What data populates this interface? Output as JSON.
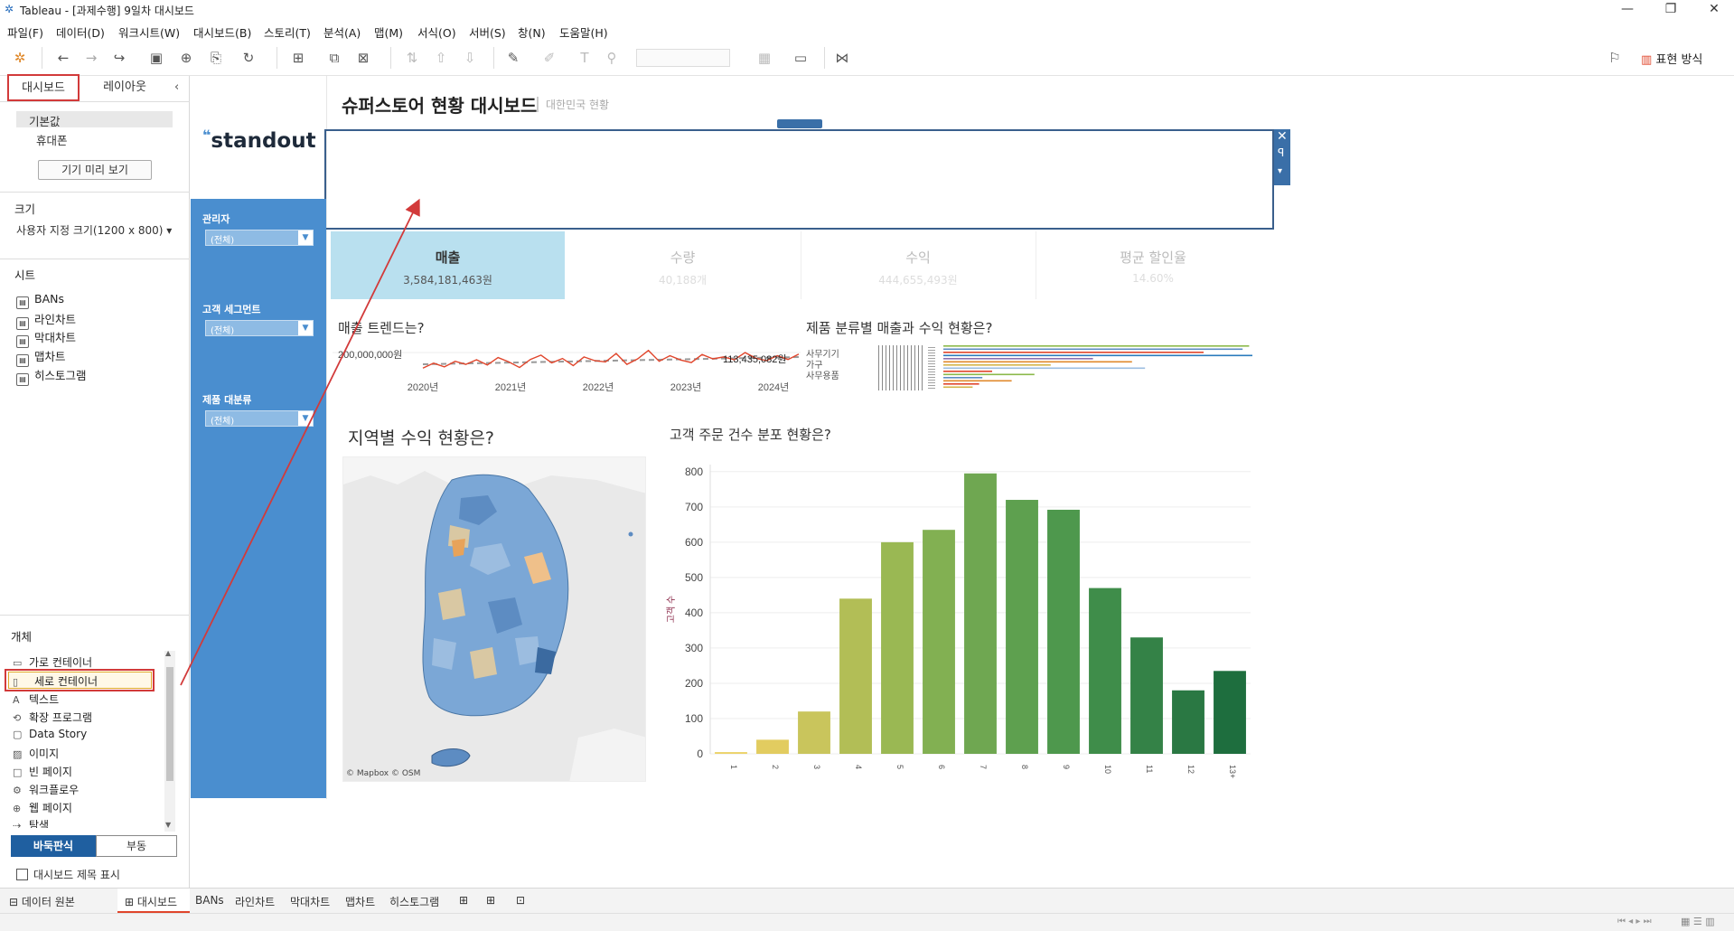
{
  "window": {
    "title": "Tableau - [과제수행] 9일차 대시보드"
  },
  "menu": [
    "파일(F)",
    "데이터(D)",
    "워크시트(W)",
    "대시보드(B)",
    "스토리(T)",
    "분석(A)",
    "맵(M)",
    "서식(O)",
    "서버(S)",
    "창(N)",
    "도움말(H)"
  ],
  "toolbar": {
    "show_me_label": "표현 방식"
  },
  "left_panel": {
    "tabs": [
      "대시보드",
      "레이아웃"
    ],
    "devices": [
      "기본값",
      "휴대폰"
    ],
    "preview_button": "기기 미리 보기",
    "size_title": "크기",
    "size_value": "사용자 지정 크기(1200 x 800)",
    "sheets_title": "시트",
    "sheets": [
      "BANs",
      "라인차트",
      "막대차트",
      "맵차트",
      "히스토그램"
    ],
    "objects_title": "개체",
    "objects": [
      {
        "icon": "horizontal-container-icon",
        "label": "가로 컨테이너"
      },
      {
        "icon": "vertical-container-icon",
        "label": "세로 컨테이너"
      },
      {
        "icon": "text-icon",
        "label": "텍스트"
      },
      {
        "icon": "extension-icon",
        "label": "확장 프로그램"
      },
      {
        "icon": "data-story-icon",
        "label": "Data Story"
      },
      {
        "icon": "image-icon",
        "label": "이미지"
      },
      {
        "icon": "blank-icon",
        "label": "빈 페이지"
      },
      {
        "icon": "workflow-icon",
        "label": "워크플로우"
      },
      {
        "icon": "web-page-icon",
        "label": "웹 페이지"
      },
      {
        "icon": "navigation-icon",
        "label": "탐색"
      }
    ],
    "mode_buttons": [
      "바둑판식",
      "부동"
    ],
    "show_title_label": "대시보드 제목 표시"
  },
  "dashboard": {
    "logo": "standout",
    "title": "슈퍼스토어 현황 대시보드",
    "subtitle": "대한민국 현황",
    "filters": [
      {
        "label": "관리자",
        "value": "(전체)"
      },
      {
        "label": "고객 세그먼트",
        "value": "(전체)"
      },
      {
        "label": "제품 대분류",
        "value": "(전체)"
      }
    ],
    "bans": [
      {
        "label": "매출",
        "value": "3,584,181,463원",
        "active": true
      },
      {
        "label": "수량",
        "value": "40,188개",
        "active": false
      },
      {
        "label": "수익",
        "value": "444,655,493원",
        "active": false
      },
      {
        "label": "평균 할인율",
        "value": "14.60%",
        "active": false
      }
    ],
    "q_trend": "매출 트렌드는?",
    "q_category": "제품 분류별 매출과 수익 현황은?",
    "q_map": "지역별 수익 현황은?",
    "q_hist": "고객 주문 건수 분포 현황은?",
    "trend_ytick": "200,000,000원",
    "trend_last_label": "113,435,082원",
    "trend_years": [
      "2020년",
      "2021년",
      "2022년",
      "2023년",
      "2024년"
    ],
    "category_labels": [
      "사무기기",
      "가구",
      "사무용품"
    ],
    "map_credit": "© Mapbox © OSM",
    "hist_ylabel": "고객 수"
  },
  "chart_data": [
    {
      "type": "line",
      "title": "매출 트렌드는?",
      "x": [
        "2020년",
        "2021년",
        "2022년",
        "2023년",
        "2024년"
      ],
      "series": [
        {
          "values": [
            68,
            84,
            72,
            90,
            80,
            95,
            78,
            102,
            88,
            70,
            96,
            110,
            85,
            99,
            76,
            104,
            92,
            88,
            115,
            80,
            98,
            125,
            90,
            108,
            94,
            86,
            112,
            98,
            104,
            95,
            118,
            100,
            92,
            108,
            96,
            113
          ]
        }
      ],
      "colors": {
        "line": "#e0452b",
        "reference": "#999999"
      }
    },
    {
      "type": "bar",
      "title": "고객 주문 건수 분포 현황은?",
      "categories": [
        "1",
        "2",
        "3",
        "4",
        "5",
        "6",
        "7",
        "8",
        "9",
        "10",
        "11",
        "12",
        "13+"
      ],
      "values": [
        5,
        40,
        120,
        440,
        600,
        635,
        795,
        720,
        692,
        470,
        330,
        180,
        235
      ],
      "ylabel": "고객 수",
      "ylim": [
        0,
        820
      ],
      "yticks": [
        0,
        100,
        200,
        300,
        400,
        500,
        600,
        700,
        800
      ],
      "colors": [
        "#ecd36b",
        "#e2cc60",
        "#c9c55c",
        "#b2be56",
        "#9ab853",
        "#82b052",
        "#6fa751",
        "#5ea04f",
        "#4e984d",
        "#3f8d4a",
        "#348247",
        "#2a7843",
        "#1e6e3e"
      ]
    }
  ]
}
